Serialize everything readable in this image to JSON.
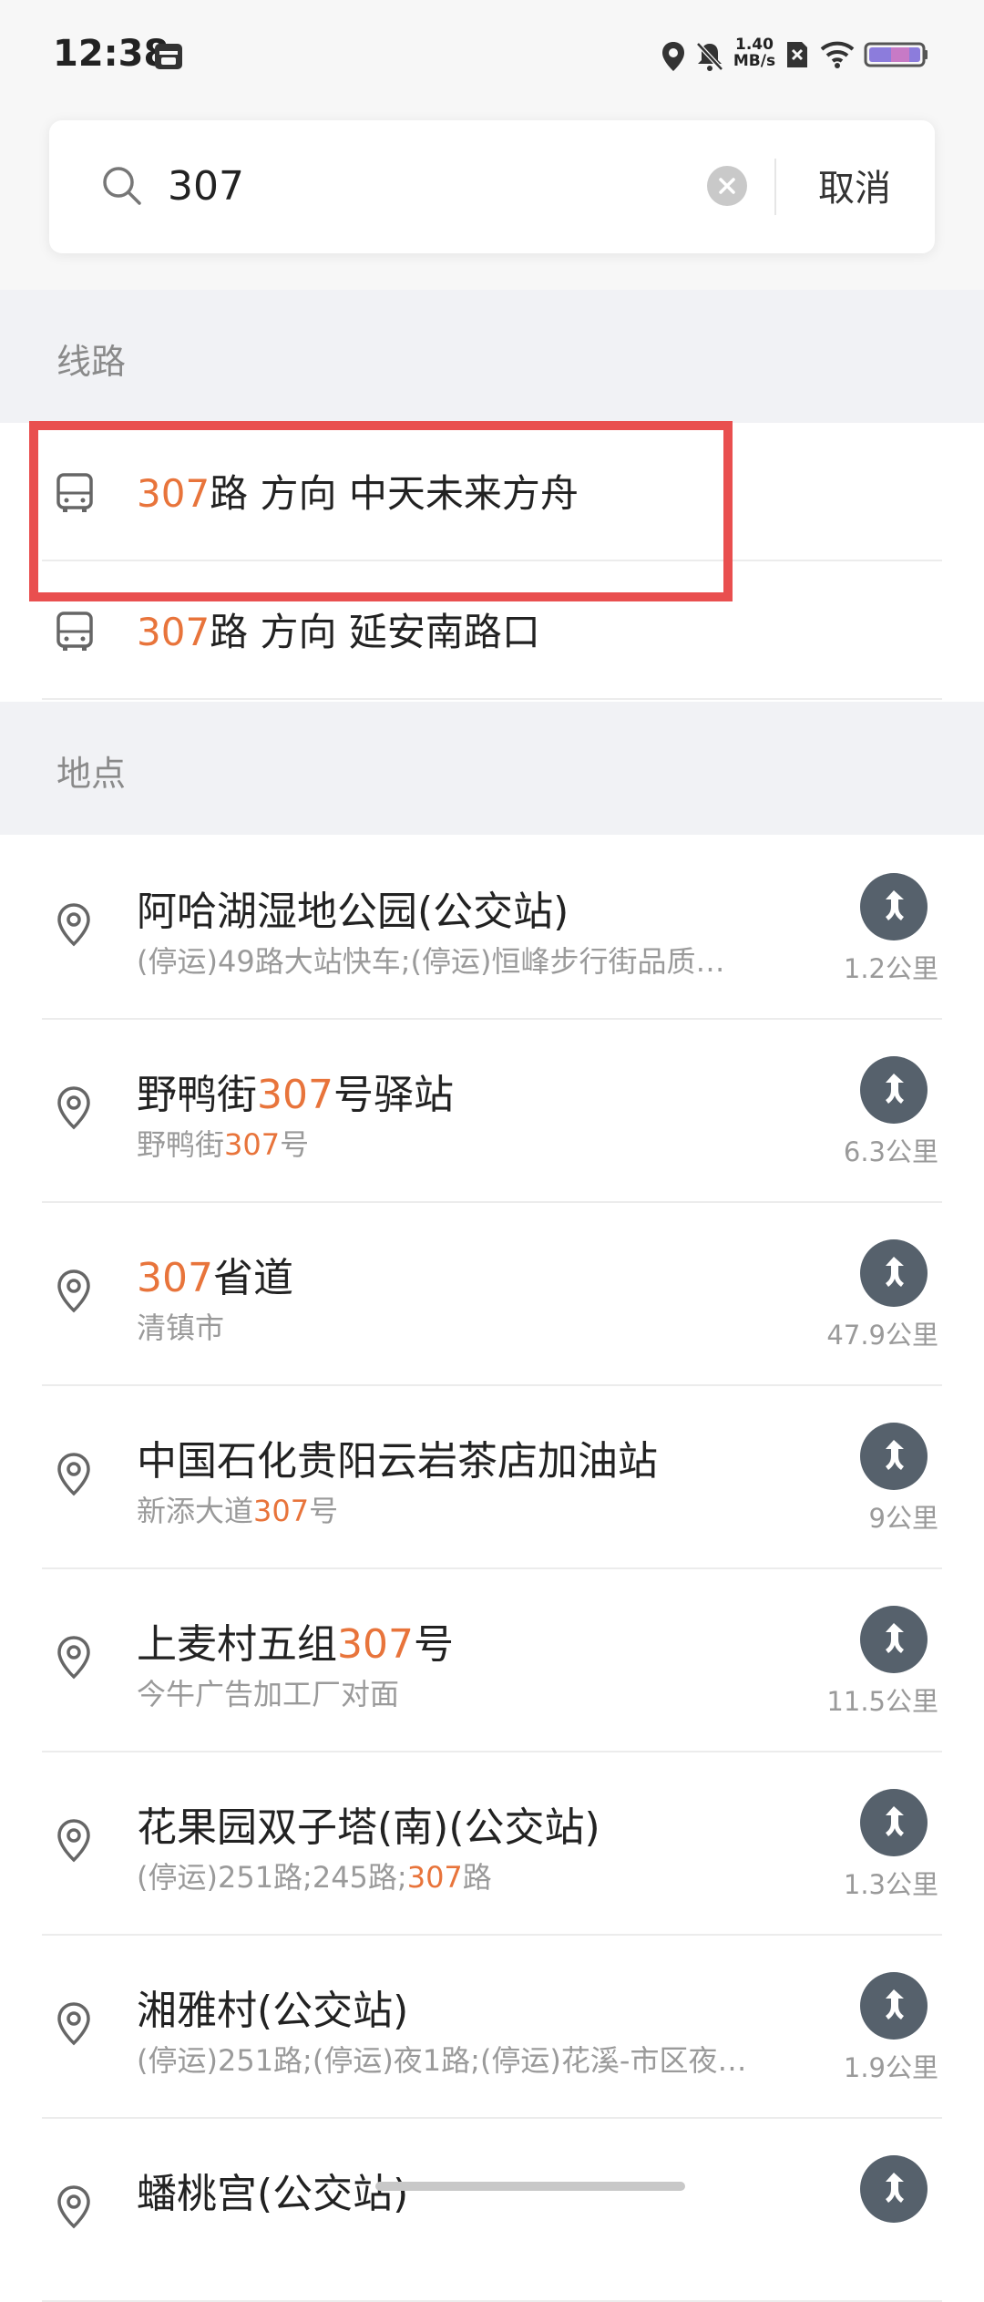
{
  "status_bar": {
    "time": "12:38",
    "speed_value": "1.40",
    "speed_unit": "MB/s",
    "icons": [
      "calendar-icon",
      "location-icon",
      "mute-icon",
      "sim-off-icon",
      "wifi-icon",
      "battery-icon"
    ]
  },
  "search": {
    "query": "307",
    "placeholder": "",
    "cancel_label": "取消"
  },
  "routes_section": {
    "header": "线路",
    "items": [
      {
        "highlight": "307",
        "rest": "路  方向  中天未来方舟"
      },
      {
        "highlight": "307",
        "rest": "路  方向  延安南路口"
      }
    ]
  },
  "places_section": {
    "header": "地点",
    "items": [
      {
        "name_pre": "阿哈湖湿地公园(公交站)",
        "name_hl": "",
        "name_post": "",
        "desc_pre": "(停运)49路大站快车;(停运)恒峰步行街品质…",
        "desc_hl": "",
        "desc_post": "",
        "distance": "1.2公里"
      },
      {
        "name_pre": "野鸭街",
        "name_hl": "307",
        "name_post": "号驿站",
        "desc_pre": "野鸭街",
        "desc_hl": "307",
        "desc_post": "号",
        "distance": "6.3公里"
      },
      {
        "name_pre": "",
        "name_hl": "307",
        "name_post": "省道",
        "desc_pre": "清镇市",
        "desc_hl": "",
        "desc_post": "",
        "distance": "47.9公里"
      },
      {
        "name_pre": "中国石化贵阳云岩茶店加油站",
        "name_hl": "",
        "name_post": "",
        "desc_pre": "新添大道",
        "desc_hl": "307",
        "desc_post": "号",
        "distance": "9公里"
      },
      {
        "name_pre": "上麦村五组",
        "name_hl": "307",
        "name_post": "号",
        "desc_pre": "今牛广告加工厂对面",
        "desc_hl": "",
        "desc_post": "",
        "distance": "11.5公里"
      },
      {
        "name_pre": "花果园双子塔(南)(公交站)",
        "name_hl": "",
        "name_post": "",
        "desc_pre": "(停运)251路;245路;",
        "desc_hl": "307",
        "desc_post": "路",
        "distance": "1.3公里"
      },
      {
        "name_pre": "湘雅村(公交站)",
        "name_hl": "",
        "name_post": "",
        "desc_pre": "(停运)251路;(停运)夜1路;(停运)花溪-市区夜…",
        "desc_hl": "",
        "desc_post": "",
        "distance": "1.9公里"
      },
      {
        "name_pre": "蟠桃宫(公交站)",
        "name_hl": "",
        "name_post": "",
        "desc_pre": "",
        "desc_hl": "",
        "desc_post": "",
        "distance": ""
      }
    ]
  },
  "colors": {
    "accent": "#e8743b",
    "nav_button": "#56616c",
    "section_bg": "#f1f2f5",
    "annotation": "#e94f4f"
  }
}
